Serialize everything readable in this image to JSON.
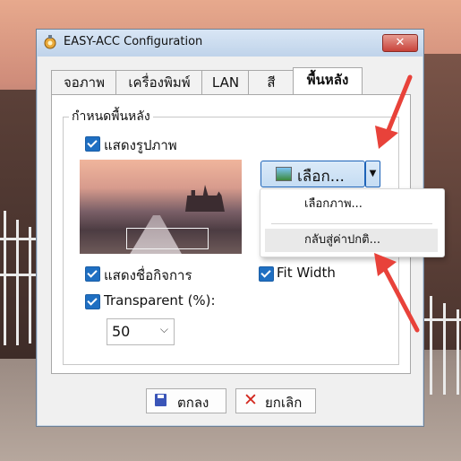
{
  "window": {
    "title": "EASY-ACC Configuration",
    "close_label": "✕"
  },
  "tabs": [
    {
      "label": "จอภาพ"
    },
    {
      "label": "เครื่องพิมพ์"
    },
    {
      "label": "LAN"
    },
    {
      "label": "สี"
    },
    {
      "label": "พื้นหลัง",
      "active": true
    }
  ],
  "group": {
    "label": "กำหนดพื้นหลัง"
  },
  "options": {
    "show_image": {
      "label": "แสดงรูปภาพ",
      "checked": true
    },
    "show_name": {
      "label": "แสดงชื่อกิจการ",
      "checked": true
    },
    "fit_width": {
      "label": "Fit Width",
      "checked": true
    },
    "transparent": {
      "label": "Transparent (%):",
      "checked": true
    }
  },
  "select_button": {
    "label": "เลือก...",
    "icon": "image-icon"
  },
  "dropdown_menu": {
    "items": [
      {
        "label": "เลือกภาพ...",
        "highlighted": false
      },
      {
        "label": "กลับสู่ค่าปกติ...",
        "highlighted": true
      }
    ]
  },
  "transparency": {
    "value": "50",
    "options": [
      "50"
    ]
  },
  "buttons": {
    "ok": "ตกลง",
    "cancel": "ยกเลิก"
  },
  "annotations": {
    "arrow_color": "#e8423a",
    "count": 2
  },
  "colors": {
    "accent": "#1f6fc2",
    "close": "#c8433a"
  }
}
